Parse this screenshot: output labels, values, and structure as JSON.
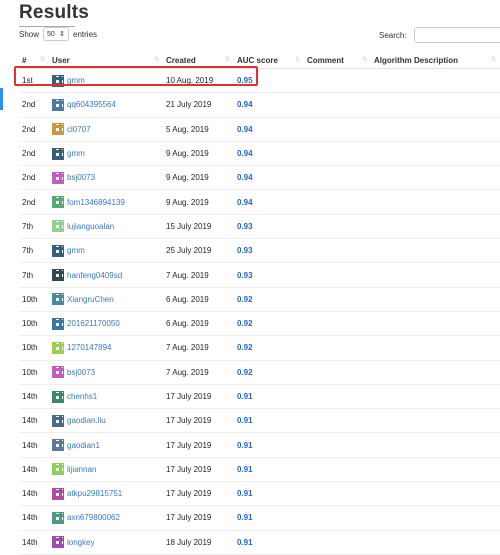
{
  "page": {
    "title": "Results"
  },
  "controls": {
    "show_label": "Show",
    "entries_value": "50",
    "entries_label": "entries",
    "search_label": "Search:",
    "search_value": ""
  },
  "table": {
    "headers": {
      "rank": "#",
      "user": "User",
      "created": "Created",
      "auc": "AUC score",
      "comment": "Comment",
      "algorithm": "Algorithm Description"
    },
    "rows": [
      {
        "rank": "1st",
        "user": "gmm",
        "created": "10 Aug. 2019",
        "auc": "0.95",
        "avatar": "#3a5f7a"
      },
      {
        "rank": "2nd",
        "user": "qq604395564",
        "created": "21 July 2019",
        "auc": "0.94",
        "avatar": "#4a7aa8"
      },
      {
        "rank": "2nd",
        "user": "cl0707",
        "created": "5 Aug. 2019",
        "auc": "0.94",
        "avatar": "#c79a3a"
      },
      {
        "rank": "2nd",
        "user": "gmm",
        "created": "9 Aug. 2019",
        "auc": "0.94",
        "avatar": "#3a5f7a"
      },
      {
        "rank": "2nd",
        "user": "bsj0073",
        "created": "9 Aug. 2019",
        "auc": "0.94",
        "avatar": "#c45ac4"
      },
      {
        "rank": "2nd",
        "user": "fom1346894139",
        "created": "9 Aug. 2019",
        "auc": "0.94",
        "avatar": "#5aa878"
      },
      {
        "rank": "7th",
        "user": "lujianguoalan",
        "created": "15 July 2019",
        "auc": "0.93",
        "avatar": "#8fd18f"
      },
      {
        "rank": "7th",
        "user": "gmm",
        "created": "25 July 2019",
        "auc": "0.93",
        "avatar": "#3a5f7a"
      },
      {
        "rank": "7th",
        "user": "hanfeng0409sd",
        "created": "7 Aug. 2019",
        "auc": "0.93",
        "avatar": "#2a4a5a"
      },
      {
        "rank": "10th",
        "user": "XiangruChen",
        "created": "6 Aug. 2019",
        "auc": "0.92",
        "avatar": "#4a8a9a"
      },
      {
        "rank": "10th",
        "user": "201621170050",
        "created": "6 Aug. 2019",
        "auc": "0.92",
        "avatar": "#3a7aa0"
      },
      {
        "rank": "10th",
        "user": "1270147894",
        "created": "7 Aug. 2019",
        "auc": "0.92",
        "avatar": "#9ad04a"
      },
      {
        "rank": "10th",
        "user": "bsj0073",
        "created": "7 Aug. 2019",
        "auc": "0.92",
        "avatar": "#c45ac4"
      },
      {
        "rank": "14th",
        "user": "chenhs1",
        "created": "17 July 2019",
        "auc": "0.91",
        "avatar": "#3a8a6a"
      },
      {
        "rank": "14th",
        "user": "gaodian.liu",
        "created": "17 July 2019",
        "auc": "0.91",
        "avatar": "#4a6a8a"
      },
      {
        "rank": "14th",
        "user": "gaodian1",
        "created": "17 July 2019",
        "auc": "0.91",
        "avatar": "#5a7a9a"
      },
      {
        "rank": "14th",
        "user": "lijiannan",
        "created": "17 July 2019",
        "auc": "0.91",
        "avatar": "#8ad05a"
      },
      {
        "rank": "14th",
        "user": "atkpu29815751",
        "created": "17 July 2019",
        "auc": "0.91",
        "avatar": "#b04aa0"
      },
      {
        "rank": "14th",
        "user": "axn679800062",
        "created": "17 July 2019",
        "auc": "0.91",
        "avatar": "#4a9a8a"
      },
      {
        "rank": "14th",
        "user": "longkey",
        "created": "18 July 2019",
        "auc": "0.91",
        "avatar": "#a04ab0"
      }
    ]
  },
  "highlight_color": "#e03030"
}
